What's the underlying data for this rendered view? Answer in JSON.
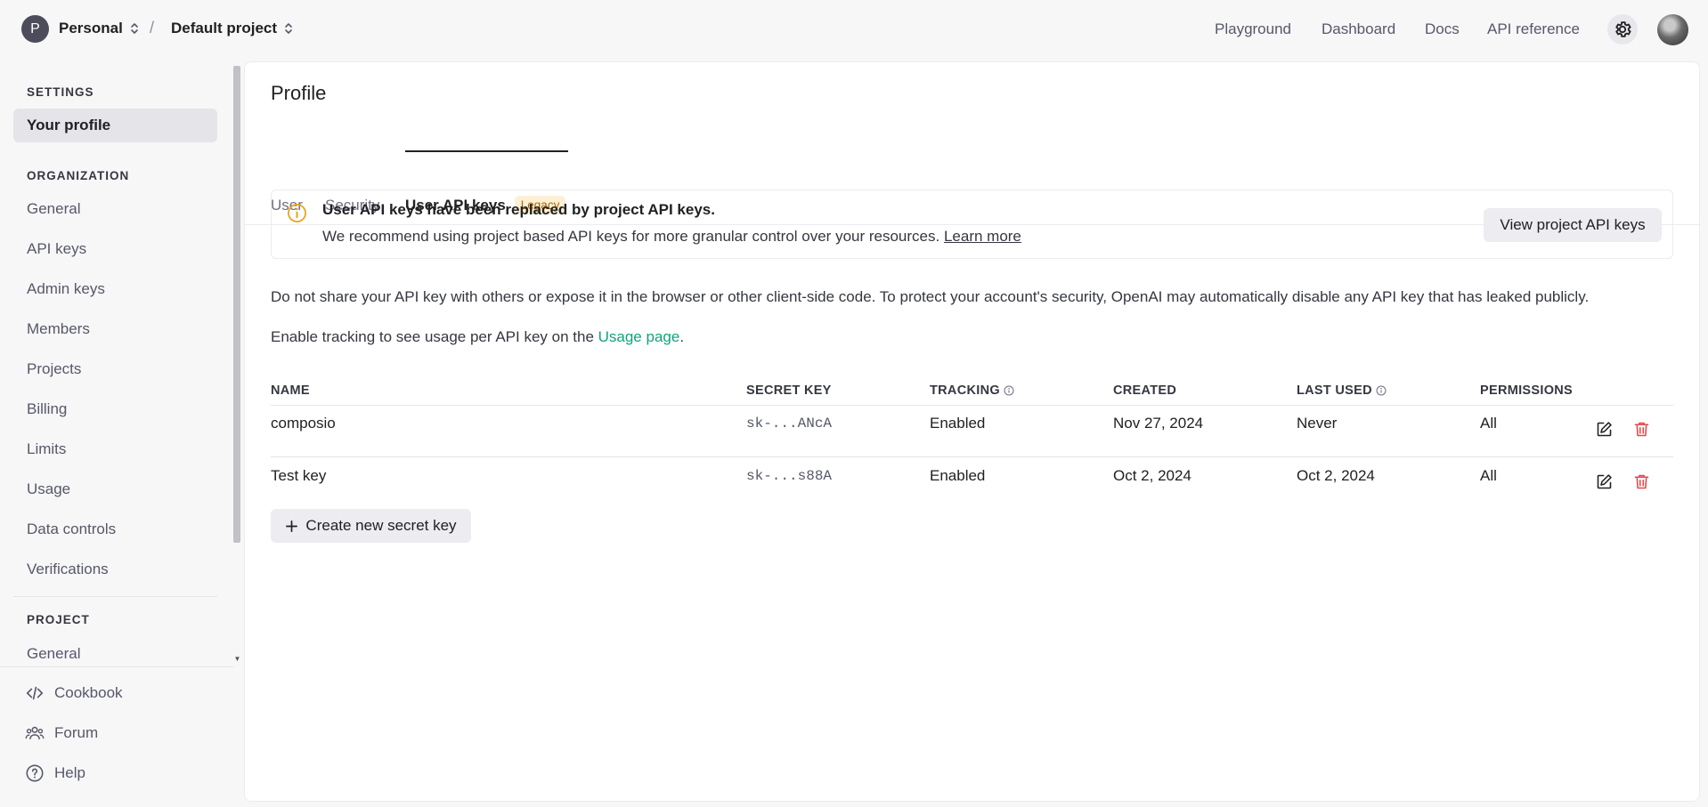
{
  "topbar": {
    "org_initial": "P",
    "org_name": "Personal",
    "separator": "/",
    "project_name": "Default project",
    "nav": [
      "Playground",
      "Dashboard",
      "Docs",
      "API reference"
    ]
  },
  "sidebar": {
    "settings_heading": "SETTINGS",
    "your_profile": "Your profile",
    "organization_heading": "ORGANIZATION",
    "org_items": [
      "General",
      "API keys",
      "Admin keys",
      "Members",
      "Projects",
      "Billing",
      "Limits",
      "Usage",
      "Data controls",
      "Verifications"
    ],
    "project_heading": "PROJECT",
    "project_items": [
      "General"
    ],
    "bottom": [
      "Cookbook",
      "Forum",
      "Help"
    ]
  },
  "main": {
    "title": "Profile",
    "tabs": [
      "User",
      "Security",
      "User API keys"
    ],
    "legacy_badge": "Legacy",
    "notice": {
      "title": "User API keys have been replaced by project API keys.",
      "text": "We recommend using project based API keys for more granular control over your resources. ",
      "link": "Learn more",
      "button": "View project API keys"
    },
    "warning": "Do not share your API key with others or expose it in the browser or other client-side code. To protect your account's security, OpenAI may automatically disable any API key that has leaked publicly.",
    "tracking_text": "Enable tracking to see usage per API key on the ",
    "tracking_link": "Usage page",
    "tracking_end": ".",
    "columns": [
      "NAME",
      "SECRET KEY",
      "TRACKING",
      "CREATED",
      "LAST USED",
      "PERMISSIONS"
    ],
    "rows": [
      {
        "name": "composio",
        "key": "sk-...ANcA",
        "tracking": "Enabled",
        "created": "Nov 27, 2024",
        "last_used": "Never",
        "permissions": "All"
      },
      {
        "name": "Test key",
        "key": "sk-...s88A",
        "tracking": "Enabled",
        "created": "Oct 2, 2024",
        "last_used": "Oct 2, 2024",
        "permissions": "All"
      }
    ],
    "create_button": "Create new secret key"
  },
  "colors": {
    "accent_link": "#10a37f",
    "delete_red": "#e5484d",
    "legacy_bg": "#fdf0d5",
    "legacy_text": "#b36200",
    "notice_icon": "#e8a317"
  },
  "icons": [
    "chevron-updown-icon",
    "gear-icon",
    "info-circle-icon",
    "edit-icon",
    "trash-icon",
    "plus-icon",
    "code-icon",
    "people-icon",
    "help-icon"
  ]
}
